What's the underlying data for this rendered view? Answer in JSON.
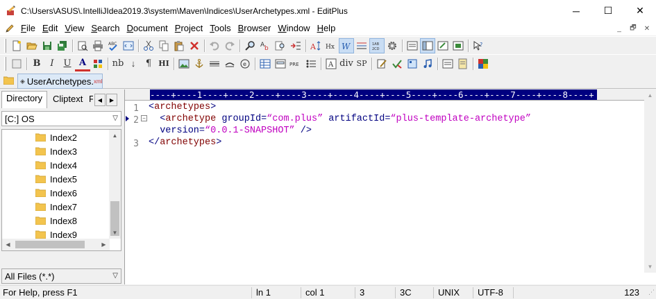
{
  "window": {
    "title": "C:\\Users\\ASUS\\.IntelliJIdea2019.3\\system\\Maven\\Indices\\UserArchetypes.xml - EditPlus",
    "minimize": "─",
    "maximize": "☐",
    "close": "✕"
  },
  "menu": {
    "items": [
      {
        "u": "F",
        "rest": "ile"
      },
      {
        "u": "E",
        "rest": "dit"
      },
      {
        "u": "V",
        "rest": "iew"
      },
      {
        "u": "S",
        "rest": "earch"
      },
      {
        "u": "D",
        "rest": "ocument"
      },
      {
        "u": "P",
        "rest": "roject"
      },
      {
        "u": "T",
        "rest": "ools"
      },
      {
        "u": "B",
        "rest": "rowser"
      },
      {
        "u": "W",
        "rest": "indow"
      },
      {
        "u": "H",
        "rest": "elp"
      }
    ],
    "mdi_minimize": "_",
    "mdi_restore": "🗗",
    "mdi_close": "✕"
  },
  "toolbar2": {
    "bold": "B",
    "italic": "I",
    "underline": "U",
    "font_color": "A",
    "nb": "nb",
    "line_break": "↓",
    "paragraph": "¶",
    "heading": "HI",
    "div": "div",
    "sp": "SP"
  },
  "tab": {
    "label": "UserArchetypes.",
    "suffix": "xml"
  },
  "left_panel": {
    "tab_directory": "Directory",
    "tab_cliptext": "Cliptext",
    "tab_third": "F",
    "drive": "[C:] OS",
    "files": [
      "Index2",
      "Index3",
      "Index4",
      "Index5",
      "Index6",
      "Index7",
      "Index8",
      "Index9"
    ],
    "filter": "All Files (*.*)"
  },
  "editor": {
    "ruler": "----+----1----+----2----+----3----+----4----+----5----+----6----+----7----+----8----+",
    "line_numbers": [
      "1",
      "2",
      "3"
    ],
    "code": {
      "l1_tag": "archetypes",
      "l2_tag": "archetype",
      "attr_groupId": "groupId",
      "val_groupId": "“com.plus”",
      "attr_artifactId": "artifactId",
      "val_artifactId": "“plus-template-archetype”",
      "attr_version": "version",
      "val_version": "“0.0.1-SNAPSHOT”",
      "self_close": "/>",
      "l3_tag": "archetypes"
    }
  },
  "status": {
    "help": "For Help, press F1",
    "line": "ln 1",
    "col": "col 1",
    "lines": "3",
    "hex": "3C",
    "eol": "UNIX",
    "encoding": "UTF-8",
    "size": "123"
  }
}
